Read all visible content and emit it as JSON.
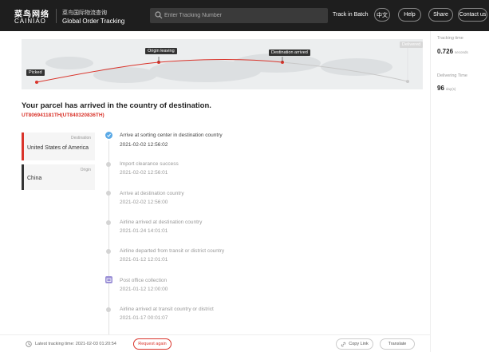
{
  "header": {
    "brand_cn": "菜鸟网络",
    "brand_en": "CAINIAO",
    "sub_cn": "菜鸟国际物流查询",
    "sub_en": "Global Order Tracking",
    "search_placeholder": "Enter Tracking Number",
    "batch_label": "Track in Batch",
    "lang_label": "中文",
    "help_label": "Help",
    "share_label": "Share",
    "contact_label": "Contact us"
  },
  "map": {
    "labels": [
      "Picked",
      "Origin leaving",
      "Destination arrived",
      "Delivered"
    ]
  },
  "stats": {
    "tracking_label": "Tracking time",
    "tracking_value": "0.726",
    "tracking_unit": "seconds",
    "delivering_label": "Delivering Time",
    "delivering_value": "96",
    "delivering_unit": "day(s)"
  },
  "parcel": {
    "status": "Your parcel has arrived in the country of destination.",
    "tracking_numbers": "UT806941181TH(UT840320836TH)"
  },
  "destination": {
    "label": "Destination",
    "country": "United States of America"
  },
  "origin": {
    "label": "Origin",
    "country": "China"
  },
  "events": [
    {
      "title": "Arrive at sorting center in destination country",
      "time": "2021-02-02 12:56:02",
      "icon": "sorting-center-icon"
    },
    {
      "title": "Import clearance success",
      "time": "2021-02-02 12:56:01",
      "icon": "dot"
    },
    {
      "title": "Arrive at destination country",
      "time": "2021-02-02 12:56:00",
      "icon": "dot"
    },
    {
      "title": "Airline arrived at destination country",
      "time": "2021-01-24 14:01:01",
      "icon": "dot"
    },
    {
      "title": "Airline departed from transit or district country",
      "time": "2021-01-12 12:01:01",
      "icon": "dot"
    },
    {
      "title": "Post office collection",
      "time": "2021-01-12 12:00:00",
      "icon": "post-office-icon"
    },
    {
      "title": "Airline arrived at transit country or district",
      "time": "2021-01-17 00:01:07",
      "icon": "dot"
    }
  ],
  "footer": {
    "latest_label": "Latest tracking time: 2021-02-03 01:20:54",
    "request_label": "Request again",
    "copy_label": "Copy Link",
    "translate_label": "Translate"
  }
}
